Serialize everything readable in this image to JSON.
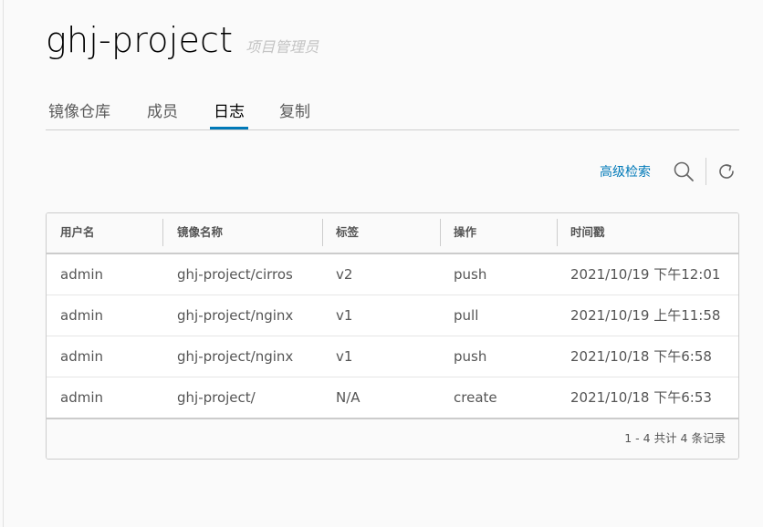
{
  "header": {
    "title": "ghj-project",
    "role": "项目管理员"
  },
  "tabs": [
    {
      "label": "镜像仓库",
      "active": false
    },
    {
      "label": "成员",
      "active": false
    },
    {
      "label": "日志",
      "active": true
    },
    {
      "label": "复制",
      "active": false
    }
  ],
  "toolbar": {
    "advanced_search": "高级检索",
    "search_icon": "search-icon",
    "refresh_icon": "refresh-icon"
  },
  "table": {
    "columns": [
      "用户名",
      "镜像名称",
      "标签",
      "操作",
      "时间戳"
    ],
    "rows": [
      [
        "admin",
        "ghj-project/cirros",
        "v2",
        "push",
        "2021/10/19 下午12:01"
      ],
      [
        "admin",
        "ghj-project/nginx",
        "v1",
        "pull",
        "2021/10/19 上午11:58"
      ],
      [
        "admin",
        "ghj-project/nginx",
        "v1",
        "push",
        "2021/10/18 下午6:58"
      ],
      [
        "admin",
        "ghj-project/",
        "N/A",
        "create",
        "2021/10/18 下午6:53"
      ]
    ],
    "footer": "1 - 4 共计 4 条记录"
  },
  "colors": {
    "accent": "#0079b8",
    "background": "#fafafa"
  }
}
